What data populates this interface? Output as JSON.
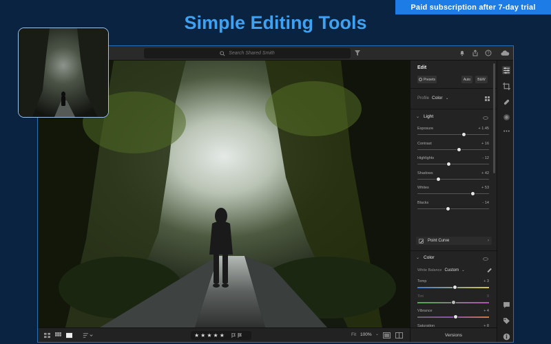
{
  "promo": {
    "text": "Paid subscription after 7-day trial"
  },
  "hero": {
    "title": "Simple Editing Tools"
  },
  "topbar": {
    "search_placeholder": "Search Shared Smith",
    "icons": [
      "search-icon",
      "filter-icon",
      "bell-icon",
      "share-icon",
      "help-icon",
      "cloud-icon"
    ]
  },
  "edit_panel": {
    "title": "Edit",
    "presets_label": "Presets",
    "auto_label": "Auto",
    "bw_label": "B&W",
    "profile_label": "Profile",
    "profile_value": "Color",
    "light": {
      "heading": "Light",
      "sliders": [
        {
          "label": "Exposure",
          "value": "+ 1.45",
          "level": 0.65
        },
        {
          "label": "Contrast",
          "value": "+ 16",
          "level": 0.58
        },
        {
          "label": "Highlights",
          "value": "- 12",
          "level": 0.44
        },
        {
          "label": "Shadows",
          "value": "+ 42",
          "level": 0.29
        },
        {
          "label": "Whites",
          "value": "+ 53",
          "level": 0.77
        },
        {
          "label": "Blacks",
          "value": "- 14",
          "level": 0.43
        }
      ]
    },
    "point_curve_label": "Point Curve",
    "color": {
      "heading": "Color",
      "wb_label": "White Balance",
      "wb_value": "Custom",
      "sliders": [
        {
          "label": "Temp",
          "value": "+ 3",
          "level": 0.52,
          "track": "temp"
        },
        {
          "label": "Tint",
          "value": "0",
          "level": 0.5,
          "track": "tint",
          "disabled": true
        },
        {
          "label": "Vibrance",
          "value": "+ 4",
          "level": 0.53,
          "track": "vib"
        },
        {
          "label": "Saturation",
          "value": "+ 8",
          "level": 0.55,
          "track": "sat"
        }
      ]
    }
  },
  "bottombar": {
    "rating": 5,
    "fit_label": "Fit",
    "zoom_label": "100%",
    "versions_label": "Versions"
  },
  "rail": {
    "icons": [
      "sliders-icon",
      "crop-icon",
      "healing-icon",
      "mask-icon",
      "more-icon",
      "comment-icon",
      "tag-icon",
      "info-icon"
    ]
  },
  "colors": {
    "accent": "#1e7ce6",
    "title_blue": "#3ea1f2",
    "background": "#0a2340"
  }
}
